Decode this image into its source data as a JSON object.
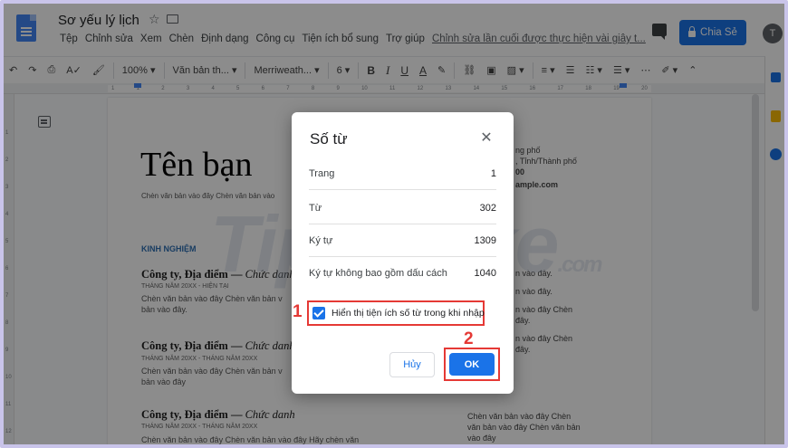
{
  "header": {
    "title": "Sơ yếu lý lịch",
    "menu": [
      "Tệp",
      "Chỉnh sửa",
      "Xem",
      "Chèn",
      "Định dạng",
      "Công cụ",
      "Tiện ích bổ sung",
      "Trợ giúp"
    ],
    "last_edit": "Chỉnh sửa lần cuối được thực hiện vài giây t...",
    "share_label": "Chia Sẻ",
    "avatar_letter": "T"
  },
  "toolbar": {
    "zoom": "100%",
    "style": "Văn bản th...",
    "font": "Merriweath...",
    "font_size": "6"
  },
  "ruler": {
    "ticks": [
      "1",
      "1",
      "2",
      "3",
      "4",
      "5",
      "6",
      "7",
      "8",
      "9",
      "10",
      "11",
      "12",
      "13",
      "14",
      "15",
      "16",
      "17",
      "18",
      "19",
      "20"
    ],
    "vticks": [
      "1",
      "2",
      "3",
      "4",
      "5",
      "6",
      "7",
      "8",
      "9",
      "10",
      "11",
      "12"
    ]
  },
  "document": {
    "name": "Tên bạn",
    "placeholder": "Chèn văn bản vào đây Chèn văn bản vào",
    "section": "KINH NGHIỆM",
    "jobs": [
      {
        "title": "Công ty, Địa điểm — ",
        "role": "Chức danh",
        "date": "THÁNG NĂM 20XX - HIỆN TẠI",
        "text1": "Chèn văn bản vào đây Chèn văn bản v",
        "text2": "bản vào đây."
      },
      {
        "title": "Công ty, Địa điểm — ",
        "role": "Chức danh",
        "date": "THÁNG NĂM 20XX - THÁNG NĂM 20XX",
        "text1": "Chèn văn bản vào đây Chèn văn bản v",
        "text2": "bản vào đây"
      },
      {
        "title": "Công ty, Địa điểm — ",
        "role": "Chức danh",
        "date": "THÁNG NĂM 20XX - THÁNG NĂM 20XX",
        "text1": "Chèn văn bản vào đây Chèn văn bản vào đây Hãy chèn văn",
        "text2": ""
      }
    ],
    "right_col": {
      "addr1": "ng phố",
      "addr2": ", Tỉnh/Thành phố",
      "addr3": "00",
      "email": "ample.com",
      "r1": "n vào đây.",
      "r2": "n vào đây.",
      "r3": "n vào đây Chèn",
      "r4": "đây.",
      "r5": "n vào đây Chèn",
      "r6": "đây.",
      "r7": "Chèn văn bản vào đây Chèn",
      "r8": "văn bản vào đây Chèn văn bản",
      "r9": "vào đây"
    }
  },
  "watermark": {
    "text": "TipsMake",
    "suffix": ".com"
  },
  "dialog": {
    "title": "Số từ",
    "rows": [
      {
        "label": "Trang",
        "value": "1"
      },
      {
        "label": "Từ",
        "value": "302"
      },
      {
        "label": "Ký tự",
        "value": "1309"
      },
      {
        "label": "Ký tự không bao gồm dấu cách",
        "value": "1040"
      }
    ],
    "checkbox_label": "Hiển thị tiện ích số từ trong khi nhập",
    "checked": true,
    "cancel_label": "Hủy",
    "ok_label": "OK"
  },
  "annotations": {
    "step1": "1",
    "step2": "2",
    "color": "#e53935"
  },
  "colors": {
    "accent": "#1a73e8"
  }
}
